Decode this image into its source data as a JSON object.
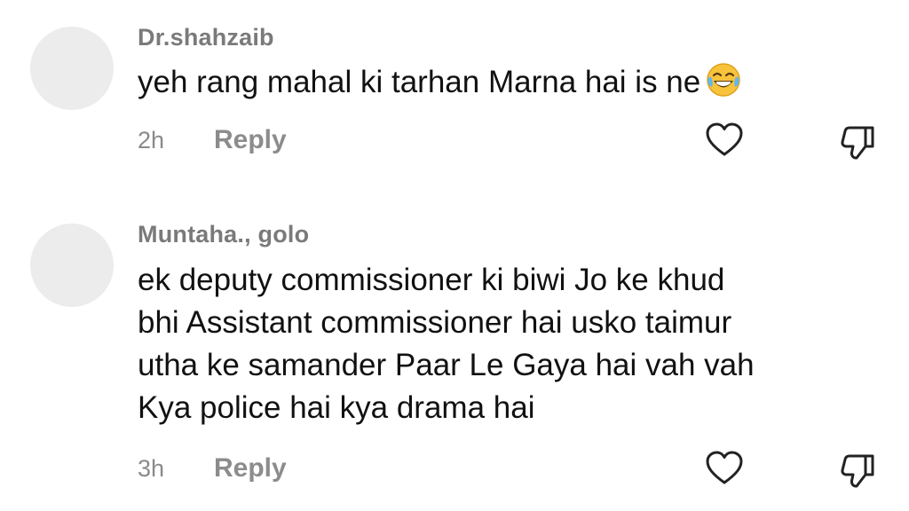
{
  "comments": [
    {
      "username": "Dr.shahzaib",
      "text": "yeh rang mahal ki tarhan Marna hai is ne",
      "emoji": "face-with-tears-of-joy",
      "time": "2h",
      "reply_label": "Reply",
      "like_icon": "heart-outline-icon",
      "dislike_icon": "thumbs-down-outline-icon"
    },
    {
      "username": "Muntaha., golo",
      "text": "ek deputy commissioner ki biwi Jo ke khud\nbhi Assistant commissioner hai usko taimur\nutha ke samander Paar Le Gaya hai vah vah\nKya police hai kya drama hai",
      "time": "3h",
      "reply_label": "Reply",
      "like_icon": "heart-outline-icon",
      "dislike_icon": "thumbs-down-outline-icon"
    }
  ],
  "colors": {
    "username": "#7a7a7a",
    "text": "#111111",
    "meta": "#8a8a8a",
    "avatar": "#ececec",
    "icon": "#222222"
  }
}
